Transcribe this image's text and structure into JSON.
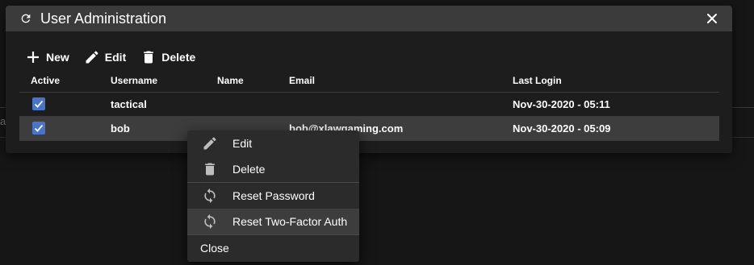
{
  "dialog": {
    "title": "User Administration",
    "icons": {
      "refresh": "refresh-icon",
      "close": "close-icon"
    }
  },
  "toolbar": {
    "new_label": "New",
    "edit_label": "Edit",
    "delete_label": "Delete"
  },
  "table": {
    "headers": {
      "active": "Active",
      "username": "Username",
      "name": "Name",
      "email": "Email",
      "last_login": "Last Login"
    },
    "rows": [
      {
        "active": true,
        "username": "tactical",
        "name": "",
        "email": "",
        "last_login": "Nov-30-2020 - 05:11"
      },
      {
        "active": true,
        "username": "bob",
        "name": "",
        "email": "bob@xlawgaming.com",
        "last_login": "Nov-30-2020 - 05:09"
      }
    ]
  },
  "context_menu": {
    "items": [
      {
        "label": "Edit",
        "icon": "pencil-icon"
      },
      {
        "label": "Delete",
        "icon": "trash-icon"
      },
      {
        "label": "Reset Password",
        "icon": "sync-icon"
      },
      {
        "label": "Reset Two-Factor Auth",
        "icon": "sync-icon"
      },
      {
        "label": "Close",
        "icon": ""
      }
    ]
  },
  "background": {
    "partial_char": "a"
  },
  "colors": {
    "checkbox": "#4a74c9",
    "titlebar": "#3b3b3b",
    "dialog_bg": "#1d1d1d",
    "selected_row": "#3d3d3d"
  }
}
